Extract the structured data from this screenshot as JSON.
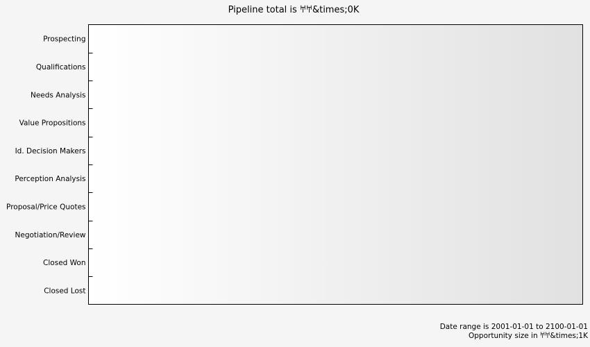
{
  "chart_data": {
    "type": "bar",
    "orientation": "horizontal",
    "title": "Pipeline total is 𐀀𐀀&times;0K",
    "categories": [
      "Prospecting",
      "Qualifications",
      "Needs Analysis",
      "Value Propositions",
      "Id. Decision Makers",
      "Perception Analysis",
      "Proposal/Price Quotes",
      "Negotiation/Review",
      "Closed Won",
      "Closed Lost"
    ],
    "values": [
      0,
      0,
      0,
      0,
      0,
      0,
      0,
      0,
      0,
      0
    ],
    "xlabel": "",
    "ylabel": "",
    "grid": false,
    "legend": "none",
    "footer": {
      "date_range": "Date range is 2001-01-01 to 2100-01-01",
      "opportunity_size": "Opportunity size in 𐀀𐀀&times;1K"
    }
  },
  "colors": {
    "page_background": "#f5f5f5",
    "plot_gradient_start": "#ffffff",
    "plot_gradient_end": "#e1e1e1",
    "axis": "#000000"
  }
}
